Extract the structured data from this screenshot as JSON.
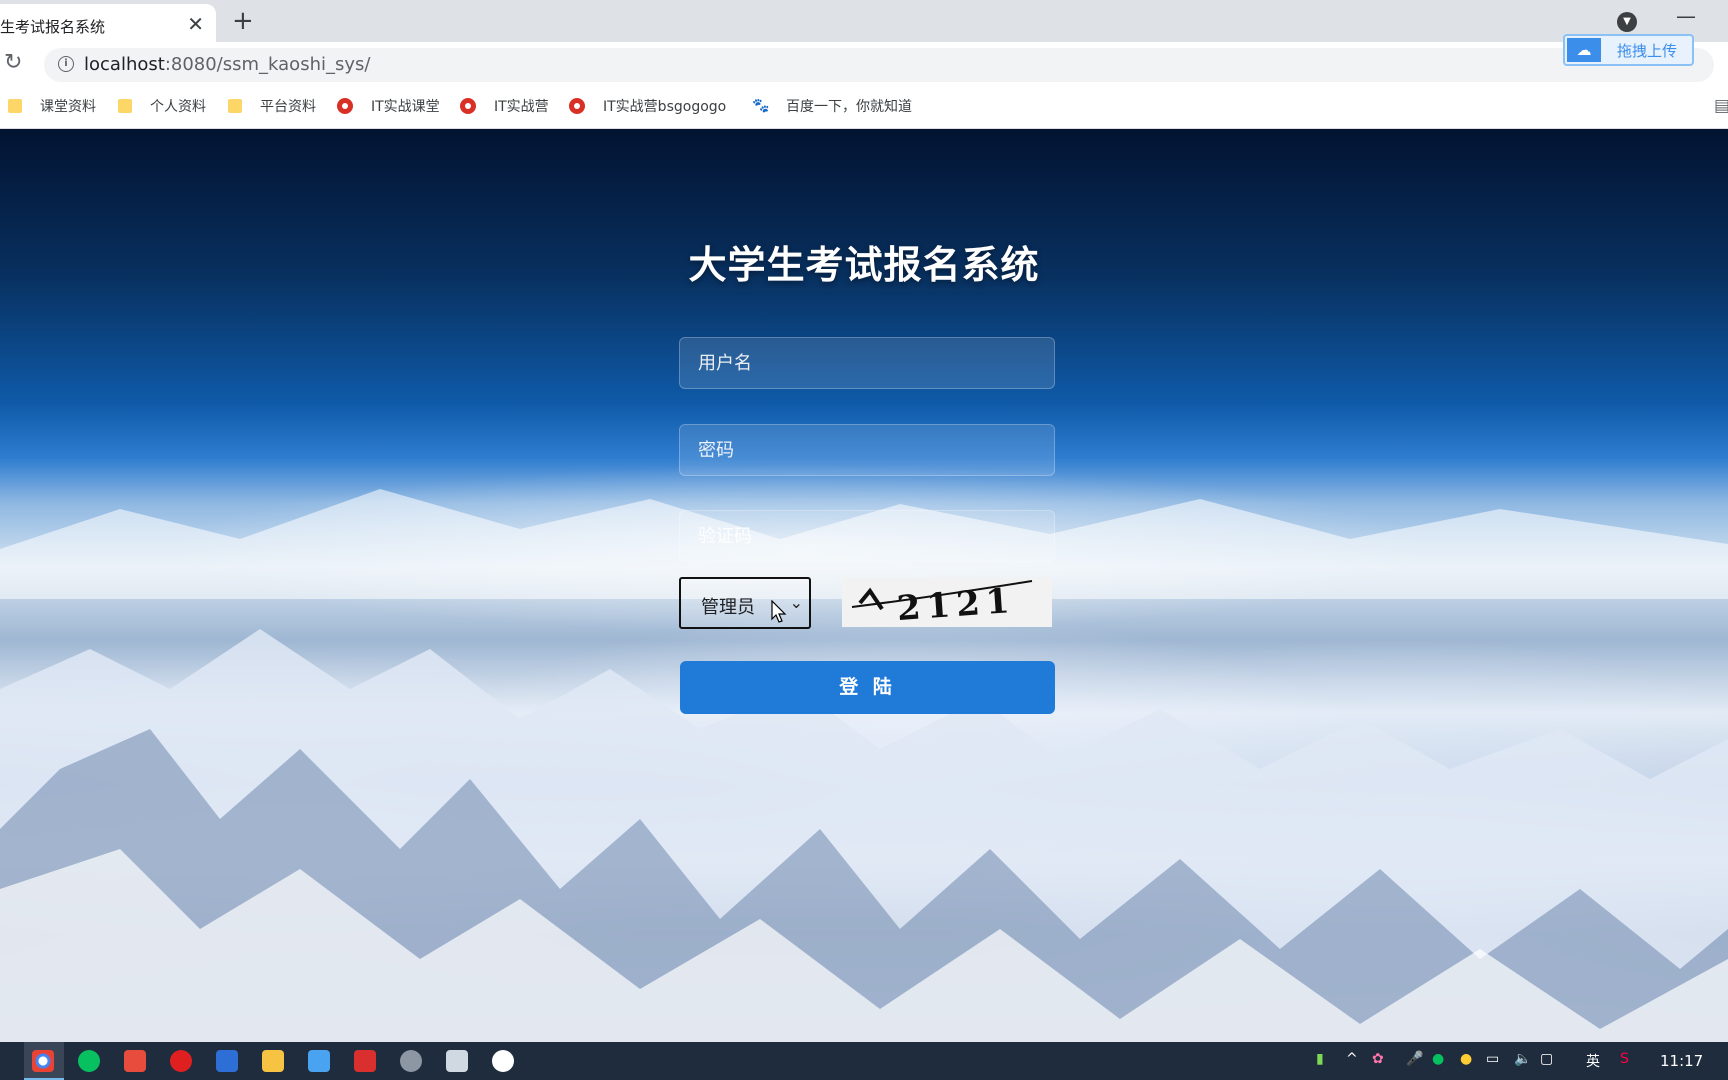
{
  "browser": {
    "tab_title": "生考试报名系统",
    "tab_close": "✕",
    "new_tab": "+",
    "url_host": "localhost",
    "url_rest": ":8080/ssm_kaoshi_sys/",
    "baidu_upload_label": "拖拽上传",
    "bookmarks": [
      {
        "label": "课堂资料",
        "icon": "folder-icon"
      },
      {
        "label": "个人资料",
        "icon": "folder-icon"
      },
      {
        "label": "平台资料",
        "icon": "folder-icon"
      },
      {
        "label": "IT实战课堂",
        "icon": "site-icon"
      },
      {
        "label": "IT实战营",
        "icon": "site-icon"
      },
      {
        "label": "IT实战营bsgogogo",
        "icon": "site-icon"
      },
      {
        "label": "百度一下，你就知道",
        "icon": "baidu-paw-icon"
      }
    ]
  },
  "page": {
    "title": "大学生考试报名系统",
    "username_placeholder": "用户名",
    "password_placeholder": "密码",
    "captcha_placeholder": "验证码",
    "role_selected": "管理员",
    "captcha_text": "2121",
    "login_label": "登 陆"
  },
  "taskbar": {
    "clock": "11:17",
    "ime": "英"
  },
  "colors": {
    "login_button": "#1f7ad8",
    "taskbar": "#1f2c3d"
  }
}
